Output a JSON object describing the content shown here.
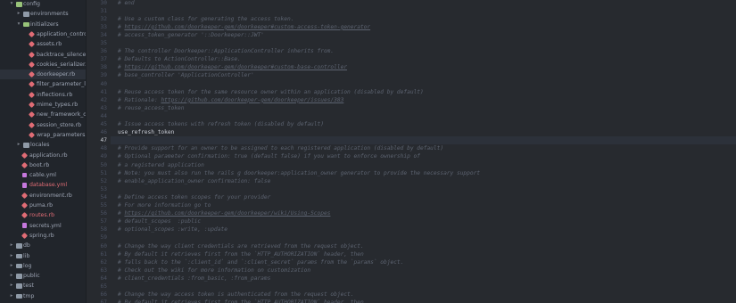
{
  "sidebar": {
    "items": [
      {
        "label": "config",
        "kind": "folder-open",
        "depth": 0,
        "arrow": "▾",
        "color": "normal"
      },
      {
        "label": "environments",
        "kind": "folder",
        "depth": 1,
        "arrow": "▸",
        "color": "normal"
      },
      {
        "label": "initializers",
        "kind": "folder-open",
        "depth": 1,
        "arrow": "▾",
        "color": "normal"
      },
      {
        "label": "application_controll",
        "kind": "ruby",
        "depth": 2,
        "color": "normal"
      },
      {
        "label": "assets.rb",
        "kind": "ruby",
        "depth": 2,
        "color": "normal"
      },
      {
        "label": "backtrace_silencers.",
        "kind": "ruby",
        "depth": 2,
        "color": "normal"
      },
      {
        "label": "cookies_serializer.rl",
        "kind": "ruby",
        "depth": 2,
        "color": "normal"
      },
      {
        "label": "doorkeeper.rb",
        "kind": "ruby",
        "depth": 2,
        "color": "normal",
        "selected": true
      },
      {
        "label": "filter_parameter_lo",
        "kind": "ruby",
        "depth": 2,
        "color": "normal"
      },
      {
        "label": "inflections.rb",
        "kind": "ruby",
        "depth": 2,
        "color": "normal"
      },
      {
        "label": "mime_types.rb",
        "kind": "ruby",
        "depth": 2,
        "color": "normal"
      },
      {
        "label": "new_framework_de",
        "kind": "ruby",
        "depth": 2,
        "color": "normal"
      },
      {
        "label": "session_store.rb",
        "kind": "ruby",
        "depth": 2,
        "color": "normal"
      },
      {
        "label": "wrap_parameters.rb",
        "kind": "ruby",
        "depth": 2,
        "color": "normal"
      },
      {
        "label": "locales",
        "kind": "folder",
        "depth": 1,
        "arrow": "▸",
        "color": "normal"
      },
      {
        "label": "application.rb",
        "kind": "ruby",
        "depth": 1,
        "color": "normal"
      },
      {
        "label": "boot.rb",
        "kind": "ruby",
        "depth": 1,
        "color": "normal"
      },
      {
        "label": "cable.yml",
        "kind": "yml",
        "depth": 1,
        "color": "normal"
      },
      {
        "label": "database.yml",
        "kind": "yml",
        "depth": 1,
        "color": "red"
      },
      {
        "label": "environment.rb",
        "kind": "ruby",
        "depth": 1,
        "color": "normal"
      },
      {
        "label": "puma.rb",
        "kind": "ruby",
        "depth": 1,
        "color": "normal"
      },
      {
        "label": "routes.rb",
        "kind": "ruby",
        "depth": 1,
        "color": "red"
      },
      {
        "label": "secrets.yml",
        "kind": "yml",
        "depth": 1,
        "color": "normal"
      },
      {
        "label": "spring.rb",
        "kind": "ruby",
        "depth": 1,
        "color": "normal"
      },
      {
        "label": "db",
        "kind": "folder",
        "depth": 0,
        "arrow": "▸",
        "color": "normal"
      },
      {
        "label": "lib",
        "kind": "folder",
        "depth": 0,
        "arrow": "▸",
        "color": "normal"
      },
      {
        "label": "log",
        "kind": "folder",
        "depth": 0,
        "arrow": "▸",
        "color": "normal"
      },
      {
        "label": "public",
        "kind": "folder",
        "depth": 0,
        "arrow": "▸",
        "color": "normal"
      },
      {
        "label": "test",
        "kind": "folder",
        "depth": 0,
        "arrow": "▸",
        "color": "normal"
      },
      {
        "label": "tmp",
        "kind": "folder",
        "depth": 0,
        "arrow": "▸",
        "color": "normal"
      }
    ]
  },
  "editor": {
    "active_line": "47",
    "lines": [
      {
        "n": "30",
        "text": "# end",
        "kind": "comment"
      },
      {
        "n": "31",
        "text": "",
        "kind": "comment"
      },
      {
        "n": "32",
        "text": "# Use a custom class for generating the access token.",
        "kind": "comment"
      },
      {
        "n": "33",
        "text": "# https://github.com/doorkeeper-gem/doorkeeper#custom-access-token-generator",
        "kind": "comment-url"
      },
      {
        "n": "34",
        "text": "# access_token_generator '::Doorkeeper::JWT'",
        "kind": "comment"
      },
      {
        "n": "35",
        "text": "",
        "kind": "comment"
      },
      {
        "n": "36",
        "text": "# The controller Doorkeeper::ApplicationController inherits from.",
        "kind": "comment"
      },
      {
        "n": "37",
        "text": "# Defaults to ActionController::Base.",
        "kind": "comment"
      },
      {
        "n": "38",
        "text": "# https://github.com/doorkeeper-gem/doorkeeper#custom-base-controller",
        "kind": "comment-url"
      },
      {
        "n": "39",
        "text": "# base_controller 'ApplicationController'",
        "kind": "comment"
      },
      {
        "n": "40",
        "text": "",
        "kind": "comment"
      },
      {
        "n": "41",
        "text": "# Reuse access token for the same resource owner within an application (disabled by default)",
        "kind": "comment"
      },
      {
        "n": "42",
        "text": "# Rationale: https://github.com/doorkeeper-gem/doorkeeper/issues/383",
        "kind": "comment-url"
      },
      {
        "n": "43",
        "text": "# reuse_access_token",
        "kind": "comment"
      },
      {
        "n": "44",
        "text": "",
        "kind": "comment"
      },
      {
        "n": "45",
        "text": "# Issue access tokens with refresh token (disabled by default)",
        "kind": "comment"
      },
      {
        "n": "46",
        "text": "use_refresh_token",
        "kind": "plain"
      },
      {
        "n": "47",
        "text": "",
        "kind": "plain"
      },
      {
        "n": "48",
        "text": "# Provide support for an owner to be assigned to each registered application (disabled by default)",
        "kind": "comment"
      },
      {
        "n": "49",
        "text": "# Optional parameter confirmation: true (default false) if you want to enforce ownership of",
        "kind": "comment"
      },
      {
        "n": "50",
        "text": "# a registered application",
        "kind": "comment"
      },
      {
        "n": "51",
        "text": "# Note: you must also run the rails g doorkeeper:application_owner generator to provide the necessary support",
        "kind": "comment"
      },
      {
        "n": "52",
        "text": "# enable_application_owner confirmation: false",
        "kind": "comment"
      },
      {
        "n": "53",
        "text": "",
        "kind": "comment"
      },
      {
        "n": "54",
        "text": "# Define access token scopes for your provider",
        "kind": "comment"
      },
      {
        "n": "55",
        "text": "# For more information go to",
        "kind": "comment"
      },
      {
        "n": "56",
        "text": "# https://github.com/doorkeeper-gem/doorkeeper/wiki/Using-Scopes",
        "kind": "comment-url"
      },
      {
        "n": "57",
        "text": "# default_scopes  :public",
        "kind": "comment"
      },
      {
        "n": "58",
        "text": "# optional_scopes :write, :update",
        "kind": "comment"
      },
      {
        "n": "59",
        "text": "",
        "kind": "comment"
      },
      {
        "n": "60",
        "text": "# Change the way client credentials are retrieved from the request object.",
        "kind": "comment"
      },
      {
        "n": "61",
        "text": "# By default it retrieves first from the `HTTP_AUTHORIZATION` header, then",
        "kind": "comment"
      },
      {
        "n": "62",
        "text": "# falls back to the `:client_id` and `:client_secret` params from the `params` object.",
        "kind": "comment"
      },
      {
        "n": "63",
        "text": "# Check out the wiki for more information on customization",
        "kind": "comment"
      },
      {
        "n": "64",
        "text": "# client_credentials :from_basic, :from_params",
        "kind": "comment"
      },
      {
        "n": "65",
        "text": "",
        "kind": "comment"
      },
      {
        "n": "66",
        "text": "# Change the way access token is authenticated from the request object.",
        "kind": "comment"
      },
      {
        "n": "67",
        "text": "# By default it retrieves first from the `HTTP_AUTHORIZATION` header, then",
        "kind": "comment"
      }
    ]
  }
}
